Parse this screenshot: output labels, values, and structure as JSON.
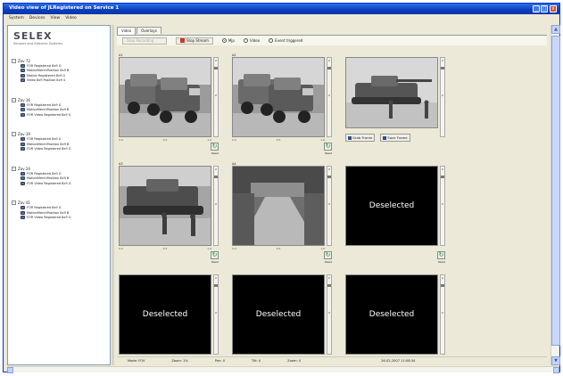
{
  "window": {
    "title": "Video view of JLRegistered on Service 1",
    "controls": {
      "minimize": "_",
      "maximize": "□",
      "close": "x"
    }
  },
  "menubar": [
    "System",
    "Devices",
    "View",
    "Video"
  ],
  "logo": {
    "name": "SELEX",
    "tagline": "Sensors and Airborne Systems"
  },
  "tree": [
    {
      "label": "Zav 72",
      "expander": "-",
      "items": [
        "FOR Registered 8x9 G",
        "MotionMerchPosition 8x9 B",
        "Motion Registered 8x9 G",
        "Video 8x9 Position 8x9 4"
      ]
    },
    {
      "label": "Zav 16",
      "expander": "-",
      "items": [
        "FOR Registered 8x9 G",
        "MotionMerchPosition 8x9 B",
        "FOR Video Registered 8x9 G"
      ]
    },
    {
      "label": "Zav 19",
      "expander": "-",
      "items": [
        "FOR Registered 8x9 G",
        "MotionMerchPosition 8x9 B",
        "FOR Video Registered 8x9 G"
      ]
    },
    {
      "label": "Zav 24",
      "expander": "-",
      "items": [
        "FOR Registered 8x9 G",
        "MotionMerchPosition 8x9 B",
        "FOR Video Registered 8x9 G"
      ]
    },
    {
      "label": "Zav 41",
      "expander": "-",
      "items": [
        "FOR Registered 8x9 G",
        "MotionMerchPosition 8x9 B",
        "FOR Video Registered 8x9 G"
      ]
    }
  ],
  "tabs": [
    "Video",
    "Overlays"
  ],
  "toolbar": {
    "disabled_button": "Stop Recording",
    "record_button": "Stop Stream",
    "radios": [
      {
        "label": "Mjp",
        "selected": true
      },
      {
        "label": "Video",
        "selected": false
      },
      {
        "label": "Event triggered",
        "selected": false
      }
    ]
  },
  "cells": [
    {
      "id": "c1",
      "label": "A1",
      "type": "video",
      "scene": "trucks",
      "ticks": [
        "0.0",
        "0.5",
        "1.0"
      ],
      "refresh": true,
      "refresh_label": "Reset"
    },
    {
      "id": "c2",
      "label": "A2",
      "type": "video",
      "scene": "trucks",
      "ticks": [
        "0.0",
        "0.5",
        "1.0"
      ],
      "refresh": true,
      "refresh_label": "Reset"
    },
    {
      "id": "c3",
      "label": "",
      "type": "video",
      "scene": "tank",
      "buttons": [
        "Grab Frame",
        "Save Frame"
      ]
    },
    {
      "id": "c4",
      "label": "A3",
      "type": "video",
      "scene": "tank-soldiers",
      "ticks": [
        "0.0",
        "0.5",
        "1.0"
      ],
      "refresh": true,
      "refresh_label": "Reset"
    },
    {
      "id": "c5",
      "label": "A4",
      "type": "video",
      "scene": "road",
      "ticks": [
        "0.0",
        "0.5",
        "1.0"
      ],
      "refresh": true,
      "refresh_label": "Reset"
    },
    {
      "id": "c6",
      "label": "",
      "type": "deselected",
      "text": "Deselected",
      "refresh": true,
      "refresh_label": "Reset"
    },
    {
      "id": "c7",
      "label": "",
      "type": "deselected",
      "text": "Deselected"
    },
    {
      "id": "c8",
      "label": "",
      "type": "deselected",
      "text": "Deselected"
    },
    {
      "id": "c9",
      "label": "",
      "type": "deselected",
      "text": "Deselected"
    }
  ],
  "status": [
    "Mode: FOV",
    "Zoom: 1%",
    "Pan: 0",
    "Tilt: 0",
    "Zoom: 0",
    "26-02-2007 11:08:34"
  ],
  "colors": {
    "title_bar": "#0a3ebd",
    "window_bg": "#ece9d8",
    "refresh_green": "#1c8b2a",
    "deselected_bg": "#000000"
  }
}
